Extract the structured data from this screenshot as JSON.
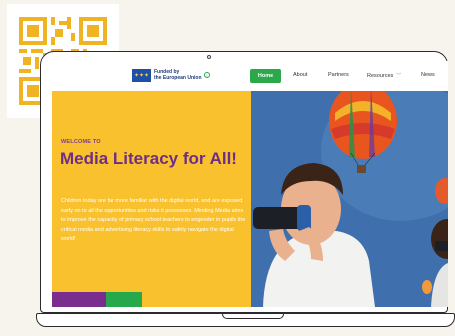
{
  "nav": {
    "eu_line1": "Funded by",
    "eu_line2": "the European Union",
    "info": "i",
    "items": [
      "Home",
      "About",
      "Partners",
      "Resources",
      "News"
    ]
  },
  "hero": {
    "welcome": "WELCOME TO",
    "title": "Media Literacy for All!",
    "body": "Children today are far more familiar with the digital world, and are exposed early on to all the opportunities and risks it possesses. Minding Media aims to improve the capacity of primary school teachers to engender in pupils the critical media and advertising literacy skills to safely navigate the digital world!"
  },
  "colors": {
    "accent_yellow": "#f8c12d",
    "accent_purple": "#6d2f86",
    "accent_green": "#2aa84a",
    "qr_color": "#f0b324"
  },
  "icons": [
    "qr-code-icon",
    "eu-flag-icon",
    "info-icon",
    "chevron-down-icon",
    "hot-air-balloon",
    "vr-headset"
  ]
}
